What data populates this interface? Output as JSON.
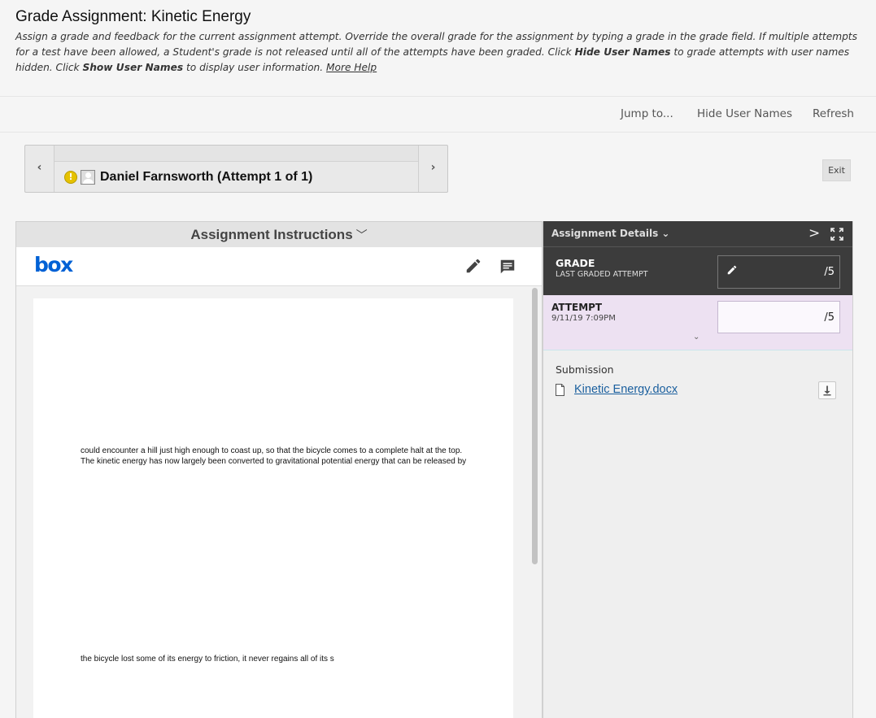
{
  "header": {
    "title": "Grade Assignment: Kinetic Energy",
    "desc_part1": "Assign a grade and feedback for the current assignment attempt. Override the overall grade for the assignment by typing a grade in the grade field. If multiple attempts for a test have been allowed, a Student's grade is not released until all of the attempts have been graded. Click ",
    "desc_bold1": "Hide User Names",
    "desc_part2": " to grade attempts with user names hidden. Click ",
    "desc_bold2": "Show User Names",
    "desc_part3": " to display user information. ",
    "more_help": "More Help"
  },
  "actions": {
    "jump_to": "Jump to...",
    "hide_user_names": "Hide User Names",
    "refresh": "Refresh"
  },
  "navigator": {
    "prev": "‹",
    "next": "›",
    "student_name": "Daniel Farnsworth (Attempt 1 of 1)",
    "warning_glyph": "!"
  },
  "exit_label": "Exit",
  "instructions": {
    "bar_label": "Assignment Instructions",
    "chevron": "﹀",
    "box_logo": "box"
  },
  "document": {
    "paragraph1": "could encounter a hill just high enough to coast up, so that the bicycle comes to a complete halt at the top. The kinetic energy has now largely been converted to gravitational potential energy that can be released by",
    "paragraph2": "the bicycle lost some of its energy to friction, it never regains all of its s"
  },
  "details": {
    "title": "Assignment Details",
    "chevron": "⌄",
    "next": ">",
    "grade_label": "GRADE",
    "grade_sub": "LAST GRADED ATTEMPT",
    "grade_value": "/5",
    "attempt_label": "ATTEMPT",
    "attempt_date": "9/11/19 7:09PM",
    "attempt_value": "/5",
    "expand_chevron": "⌄",
    "submission_label": "Submission",
    "file_name": "Kinetic Energy.docx"
  },
  "icons": {
    "pencil": "pencil-icon",
    "comment": "comment-icon",
    "expand": "expand-icon",
    "file": "file-icon",
    "download": "download-icon",
    "warning": "warning-icon",
    "avatar": "avatar-icon"
  },
  "colors": {
    "box_blue": "#0061d5",
    "details_dark": "#3c3c3c",
    "attempt_bg": "#ede1f2",
    "link": "#1a5f9e"
  }
}
